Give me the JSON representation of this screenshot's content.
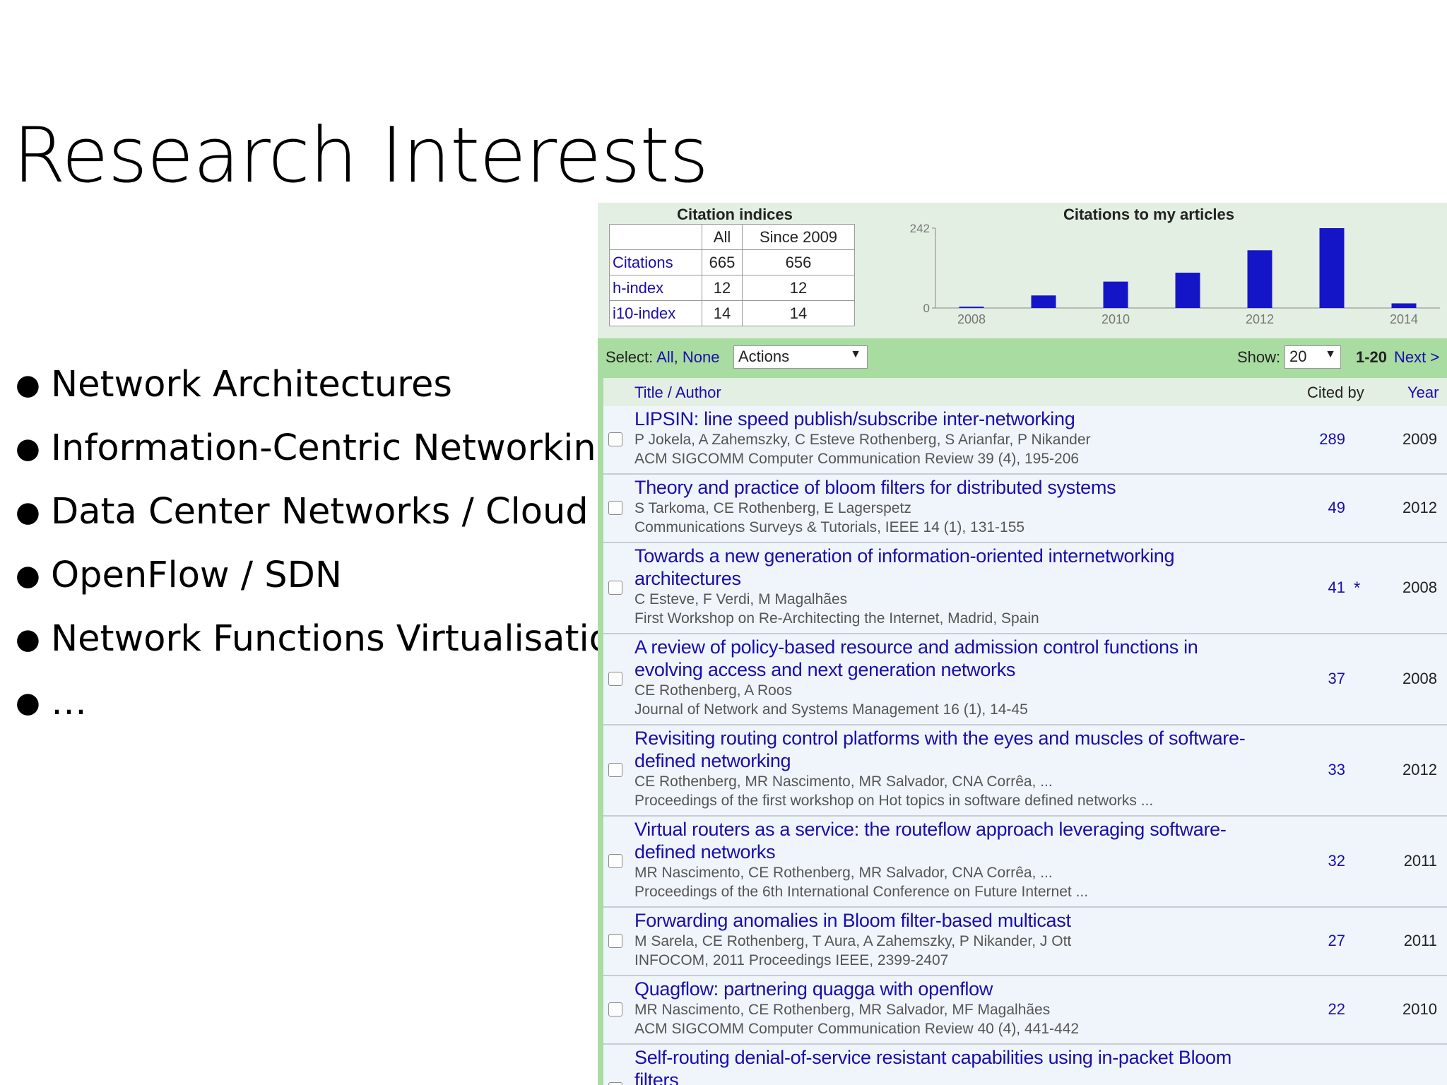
{
  "slide": {
    "title": "Research Interests",
    "bullets": [
      "Network Architectures",
      "Information-Centric Networking",
      "Data Center Networks / Cloud",
      "OpenFlow / SDN",
      "Network Functions Virtualisation",
      "…"
    ]
  },
  "citation_indices": {
    "caption": "Citation indices",
    "headers": [
      "",
      "All",
      "Since 2009"
    ],
    "rows": [
      {
        "label": "Citations",
        "all": "665",
        "since": "656"
      },
      {
        "label": "h-index",
        "all": "12",
        "since": "12"
      },
      {
        "label": "i10-index",
        "all": "14",
        "since": "14"
      }
    ]
  },
  "chart_data": {
    "type": "bar",
    "title": "Citations to my articles",
    "categories": [
      "2008",
      "2009",
      "2010",
      "2011",
      "2012",
      "2013",
      "2014"
    ],
    "values": [
      4,
      38,
      80,
      107,
      175,
      242,
      14
    ],
    "x_tick_labels": [
      "2008",
      "2010",
      "2012",
      "2014"
    ],
    "y_tick_labels": [
      "0",
      "242"
    ],
    "ylim": [
      0,
      242
    ],
    "bar_color": "#1515c8",
    "xlabel": "",
    "ylabel": ""
  },
  "toolbar": {
    "select_label": "Select:",
    "all_link": "All",
    "comma": ",",
    "none_link": "None",
    "actions_label": "Actions",
    "show_label": "Show:",
    "show_value": "20",
    "range": "1-20",
    "next_link": "Next >"
  },
  "list_header": {
    "title_author": "Title / Author",
    "cited_by": "Cited by",
    "year": "Year"
  },
  "articles": [
    {
      "title": "LIPSIN: line speed publish/subscribe inter-networking",
      "authors": "P Jokela, A Zahemszky, C Esteve Rothenberg, S Arianfar, P Nikander",
      "venue": "ACM SIGCOMM Computer Communication Review 39 (4), 195-206",
      "cited": "289",
      "star": "",
      "year": "2009"
    },
    {
      "title": "Theory and practice of bloom filters for distributed systems",
      "authors": "S Tarkoma, CE Rothenberg, E Lagerspetz",
      "venue": "Communications Surveys & Tutorials, IEEE 14 (1), 131-155",
      "cited": "49",
      "star": "",
      "year": "2012"
    },
    {
      "title": "Towards a new generation of information-oriented internetworking architectures",
      "authors": "C Esteve, F Verdi, M Magalhães",
      "venue": "First Workshop on Re-Architecting the Internet, Madrid, Spain",
      "cited": "41",
      "star": "*",
      "year": "2008"
    },
    {
      "title": "A review of policy-based resource and admission control functions in evolving access and next generation networks",
      "authors": "CE Rothenberg, A Roos",
      "venue": "Journal of Network and Systems Management 16 (1), 14-45",
      "cited": "37",
      "star": "",
      "year": "2008"
    },
    {
      "title": "Revisiting routing control platforms with the eyes and muscles of software-defined networking",
      "authors": "CE Rothenberg, MR Nascimento, MR Salvador, CNA Corrêa, ...",
      "venue": "Proceedings of the first workshop on Hot topics in software defined networks ...",
      "cited": "33",
      "star": "",
      "year": "2012"
    },
    {
      "title": "Virtual routers as a service: the routeflow approach leveraging software-defined networks",
      "authors": "MR Nascimento, CE Rothenberg, MR Salvador, CNA Corrêa, ...",
      "venue": "Proceedings of the 6th International Conference on Future Internet ...",
      "cited": "32",
      "star": "",
      "year": "2011"
    },
    {
      "title": "Forwarding anomalies in Bloom filter-based multicast",
      "authors": "M Sarela, CE Rothenberg, T Aura, A Zahemszky, P Nikander, J Ott",
      "venue": "INFOCOM, 2011 Proceedings IEEE, 2399-2407",
      "cited": "27",
      "star": "",
      "year": "2011"
    },
    {
      "title": "Quagflow: partnering quagga with openflow",
      "authors": "MR Nascimento, CE Rothenberg, MR Salvador, MF Magalhães",
      "venue": "ACM SIGCOMM Computer Communication Review 40 (4), 441-442",
      "cited": "22",
      "star": "",
      "year": "2010"
    },
    {
      "title": "Self-routing denial-of-service resistant capabilities using in-packet Bloom filters",
      "authors": "",
      "venue": "",
      "cited": "",
      "star": "",
      "year": ""
    }
  ]
}
